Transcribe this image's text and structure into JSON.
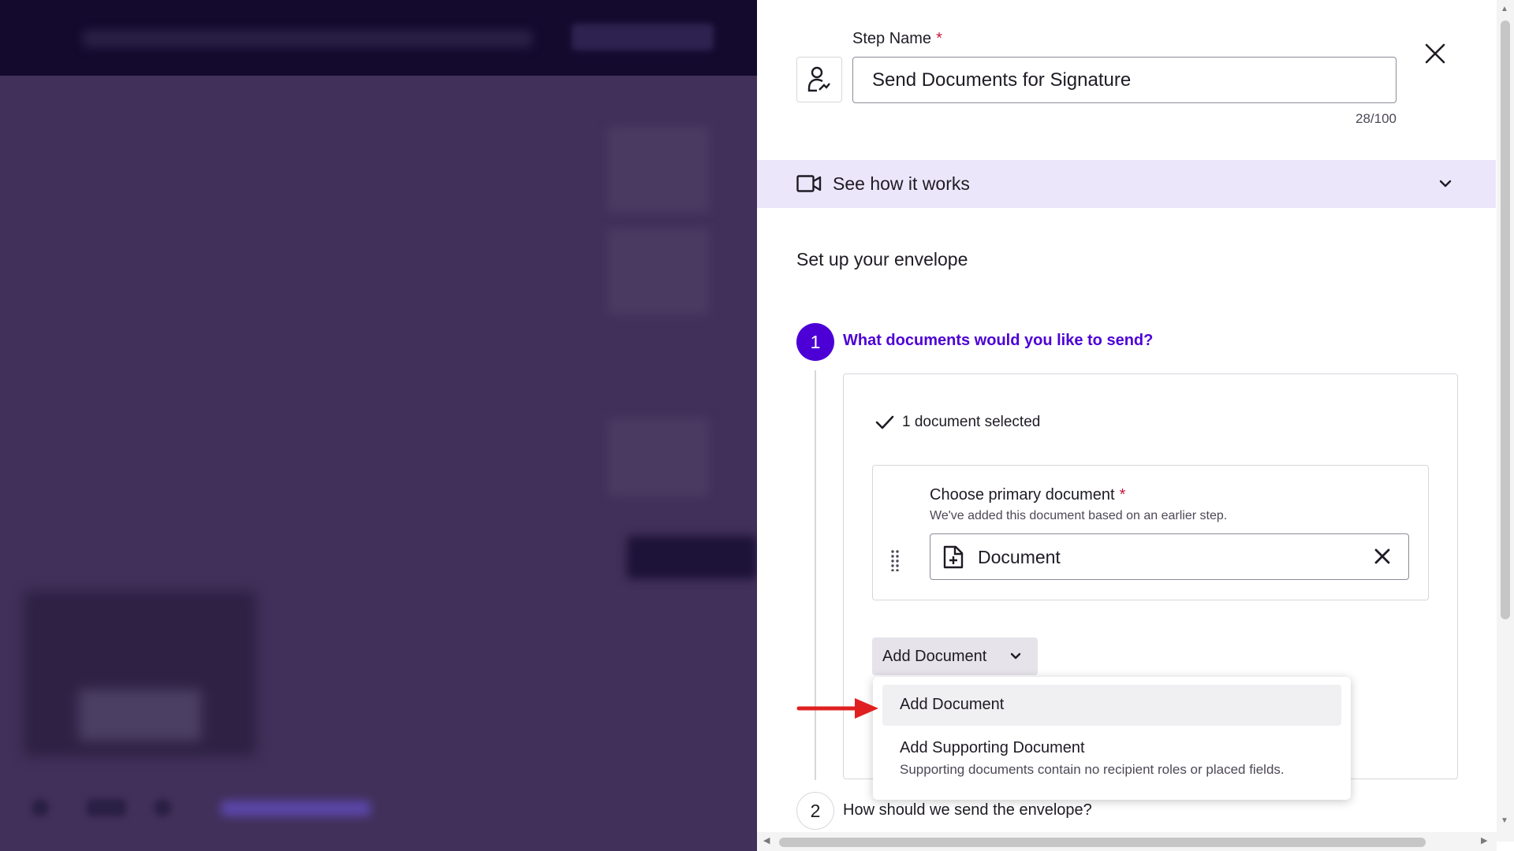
{
  "step": {
    "label": "Step Name",
    "required_mark": "*",
    "value": "Send Documents for Signature",
    "char_count": "28/100"
  },
  "how_it_works": {
    "label": "See how it works"
  },
  "envelope": {
    "title": "Set up your envelope"
  },
  "section1": {
    "number": "1",
    "question": "What documents would you like to send?",
    "selected_text": "1 document selected",
    "primary": {
      "title": "Choose primary document",
      "required_mark": "*",
      "subtitle": "We've added this document based on an earlier step.",
      "document_name": "Document"
    },
    "add_button_label": "Add Document"
  },
  "menu": {
    "items": [
      {
        "label": "Add Document"
      },
      {
        "label": "Add Supporting Document",
        "description": "Supporting documents contain no recipient roles or placed fields."
      }
    ]
  },
  "section2": {
    "number": "2",
    "question": "How should we send the envelope?"
  },
  "colors": {
    "accent": "#4c00d6",
    "required": "#c8163c",
    "highlight_bar": "#ece6fb",
    "annotation_arrow": "#e02020"
  },
  "icons": [
    "user-signature-icon",
    "close-icon",
    "video-icon",
    "chevron-down-icon",
    "checkmark-icon",
    "document-add-icon",
    "drag-handle-icon",
    "clear-icon",
    "red-arrow-icon"
  ]
}
